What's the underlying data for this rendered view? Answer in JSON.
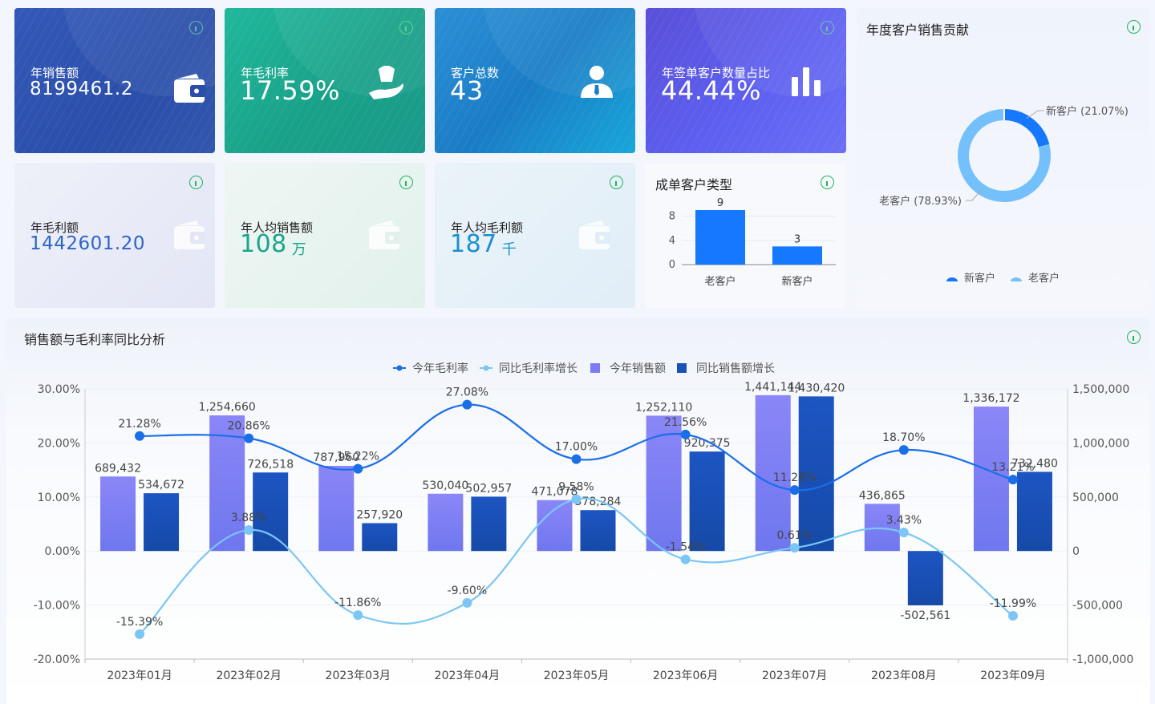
{
  "kpis": [
    {
      "label": "年销售额",
      "value": "8199461.2",
      "unit": ""
    },
    {
      "label": "年毛利率",
      "value": "17.59%",
      "unit": ""
    },
    {
      "label": "客户总数",
      "value": "43",
      "unit": ""
    },
    {
      "label": "年签单客户数量占比",
      "value": "44.44%",
      "unit": ""
    },
    {
      "label": "年毛利额",
      "value": "1442601.20",
      "unit": ""
    },
    {
      "label": "年人均销售额",
      "value": "108",
      "unit": "万"
    },
    {
      "label": "年人均毛利额",
      "value": "187",
      "unit": "千"
    }
  ],
  "icons": {
    "info": "info-icon",
    "wallet": "wallet-icon",
    "hand": "hand-money-icon",
    "user": "user-icon",
    "bars": "bar-chart-icon"
  },
  "colors": {
    "green": "#1fb55a",
    "blue": "#1677ff",
    "lightBlue": "#74c0fc",
    "purple": "#7b7cf5",
    "navy": "#1850b8"
  },
  "deal_type": {
    "title": "成单客户类型",
    "chart_data": {
      "type": "bar",
      "categories": [
        "老客户",
        "新客户"
      ],
      "values": [
        9,
        3
      ],
      "ylim": [
        0,
        9
      ],
      "yticks": [
        "0",
        "4",
        "8"
      ],
      "data_labels": [
        "9",
        "3"
      ]
    }
  },
  "contribution": {
    "title": "年度客户销售贡献",
    "chart_data": {
      "type": "pie",
      "labels": [
        "新客户",
        "老客户"
      ],
      "values": [
        21.07,
        78.93
      ],
      "slice_labels": [
        "新客户 (21.07%)",
        "老客户 (78.93%)"
      ],
      "legend": [
        "新客户",
        "老客户"
      ]
    }
  },
  "analysis": {
    "title": "销售额与毛利率同比分析",
    "legend": [
      "今年毛利率",
      "同比毛利率增长",
      "今年销售额",
      "同比销售额增长"
    ],
    "chart_data": {
      "type": "bar",
      "categories": [
        "2023年01月",
        "2023年02月",
        "2023年03月",
        "2023年04月",
        "2023年05月",
        "2023年06月",
        "2023年07月",
        "2023年08月",
        "2023年09月"
      ],
      "left_axis": {
        "ylim": [
          -20,
          30
        ],
        "ticks": [
          "-20.00%",
          "-10.00%",
          "0.00%",
          "10.00%",
          "20.00%",
          "30.00%"
        ]
      },
      "right_axis": {
        "ylim": [
          -1000000,
          1500000
        ],
        "ticks": [
          "-1,000,000",
          "-500,000",
          "0",
          "500,000",
          "1,000,000",
          "1,500,000"
        ]
      },
      "series": [
        {
          "name": "今年销售额",
          "type": "bar",
          "axis": "right",
          "values": [
            689432,
            1254660,
            787960,
            530040,
            471078,
            1252110,
            1441144,
            436865,
            1336172
          ],
          "labels": [
            "689,432",
            "1,254,660",
            "787,960",
            "530,040",
            "471,078",
            "1,252,110",
            "1,441,144",
            "436,865",
            "1,336,172"
          ]
        },
        {
          "name": "同比销售额增长",
          "type": "bar",
          "axis": "right",
          "values": [
            534672,
            726518,
            257920,
            502957,
            378284,
            920375,
            1430420,
            -502561,
            732480
          ],
          "labels": [
            "534,672",
            "726,518",
            "257,920",
            "502,957",
            "378,284",
            "920,375",
            "1,430,420",
            "-502,561",
            "732,480"
          ]
        },
        {
          "name": "今年毛利率",
          "type": "line",
          "axis": "left",
          "values": [
            21.28,
            20.86,
            15.22,
            27.08,
            17.0,
            21.56,
            11.28,
            18.7,
            13.21
          ],
          "labels": [
            "21.28%",
            "20.86%",
            "15.22%",
            "27.08%",
            "17.00%",
            "21.56%",
            "11.28%",
            "18.70%",
            "13.21%"
          ]
        },
        {
          "name": "同比毛利率增长",
          "type": "line",
          "axis": "left",
          "values": [
            -15.39,
            3.88,
            -11.86,
            -9.6,
            9.58,
            -1.54,
            0.61,
            3.43,
            -11.99
          ],
          "labels": [
            "-15.39%",
            "3.88%",
            "-11.86%",
            "-9.60%",
            "9.58%",
            "-1.54%",
            "0.61%",
            "3.43%",
            "-11.99%"
          ]
        }
      ]
    }
  }
}
